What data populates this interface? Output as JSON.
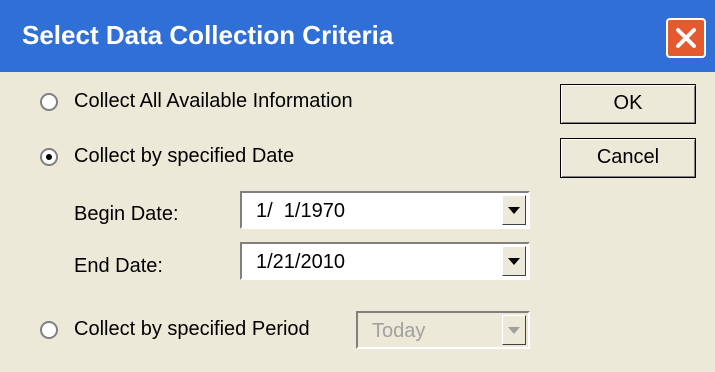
{
  "window": {
    "title": "Select Data Collection Criteria"
  },
  "options": {
    "all": {
      "label": "Collect All Available Information",
      "selected": false
    },
    "by_date": {
      "label": "Collect by specified Date",
      "selected": true
    },
    "by_period": {
      "label": "Collect by specified Period",
      "selected": false
    }
  },
  "dates": {
    "begin_label": "Begin Date:",
    "begin_value": "1/  1/1970",
    "end_label": "End Date:",
    "end_value": "1/21/2010"
  },
  "period": {
    "value": "Today",
    "disabled": true
  },
  "buttons": {
    "ok": "OK",
    "cancel": "Cancel"
  },
  "colors": {
    "titlebar": "#2f6fd6",
    "close": "#e45a2e",
    "face": "#ece9d8"
  },
  "icons": {
    "close": "close-x-icon",
    "dropdown": "chevron-down-icon"
  }
}
